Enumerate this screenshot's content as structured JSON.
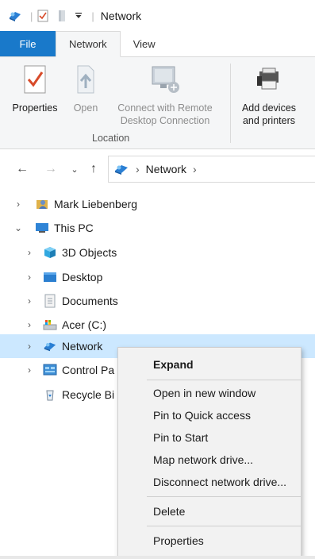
{
  "window": {
    "title": "Network"
  },
  "quick_access": {
    "icons": [
      "network-app-icon",
      "properties-check-icon",
      "new-folder-icon",
      "customize-dropdown-icon"
    ]
  },
  "ribbon_tabs": [
    {
      "label": "File"
    },
    {
      "label": "Network"
    },
    {
      "label": "View"
    }
  ],
  "ribbon": {
    "properties_label": "Properties",
    "open_label": "Open",
    "remote_label_line1": "Connect with Remote",
    "remote_label_line2": "Desktop Connection",
    "group_location": "Location",
    "add_devices_line1": "Add devices",
    "add_devices_line2": "and printers"
  },
  "address": {
    "path": [
      "Network"
    ]
  },
  "tree": [
    {
      "label": "Mark Liebenberg",
      "icon": "user-folder-icon",
      "expander": "collapsed",
      "level": 0
    },
    {
      "label": "This PC",
      "icon": "this-pc-icon",
      "expander": "expanded",
      "level": 0
    },
    {
      "label": "3D Objects",
      "icon": "3d-objects-icon",
      "expander": "collapsed",
      "level": 1
    },
    {
      "label": "Desktop",
      "icon": "desktop-icon",
      "expander": "collapsed",
      "level": 1
    },
    {
      "label": "Documents",
      "icon": "documents-icon",
      "expander": "collapsed",
      "level": 1
    },
    {
      "label": "Acer (C:)",
      "icon": "drive-icon",
      "expander": "collapsed",
      "level": 1
    },
    {
      "label": "Network",
      "icon": "network-icon",
      "expander": "collapsed",
      "level": 1,
      "selected": true
    },
    {
      "label": "Control Pa",
      "icon": "control-panel-icon",
      "expander": "collapsed",
      "level": 1
    },
    {
      "label": "Recycle Bi",
      "icon": "recycle-bin-icon",
      "expander": "none",
      "level": 1
    }
  ],
  "context_menu": {
    "expand": "Expand",
    "open_new_window": "Open in new window",
    "pin_quick_access": "Pin to Quick access",
    "pin_start": "Pin to Start",
    "map_drive": "Map network drive...",
    "disconnect_drive": "Disconnect network drive...",
    "delete": "Delete",
    "properties": "Properties"
  },
  "colors": {
    "file_tab": "#1979ca",
    "selection": "#cce8ff",
    "ribbon_bg": "#f5f6f7"
  }
}
